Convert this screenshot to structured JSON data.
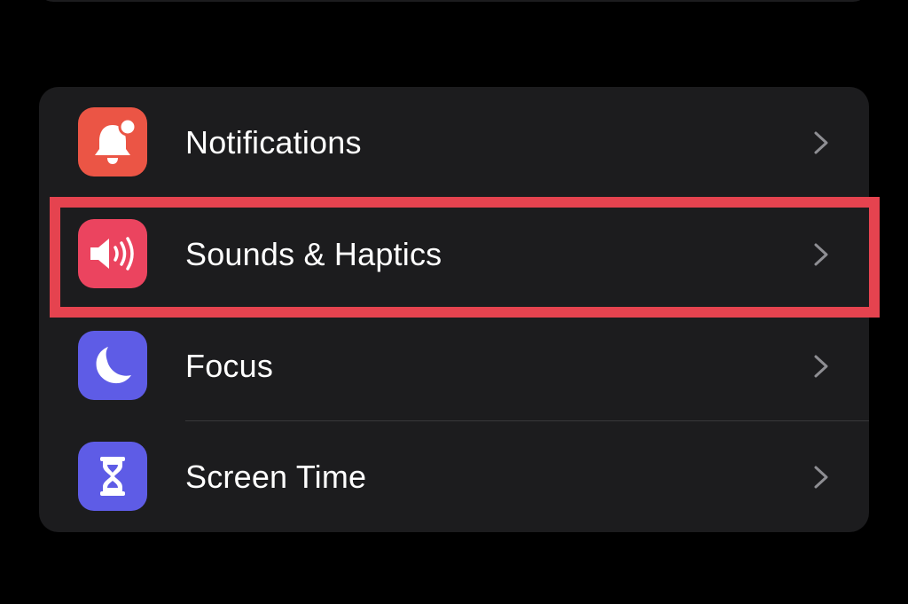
{
  "settings": {
    "items": [
      {
        "label": "Notifications",
        "icon": "notifications-bell-icon",
        "icon_color": "#eb5545"
      },
      {
        "label": "Sounds & Haptics",
        "icon": "speaker-icon",
        "icon_color": "#eb445f"
      },
      {
        "label": "Focus",
        "icon": "moon-icon",
        "icon_color": "#5e5ce6"
      },
      {
        "label": "Screen Time",
        "icon": "hourglass-icon",
        "icon_color": "#5e5ce6"
      }
    ],
    "highlighted_item": "Sounds & Haptics",
    "highlight_color": "#e5434f"
  }
}
